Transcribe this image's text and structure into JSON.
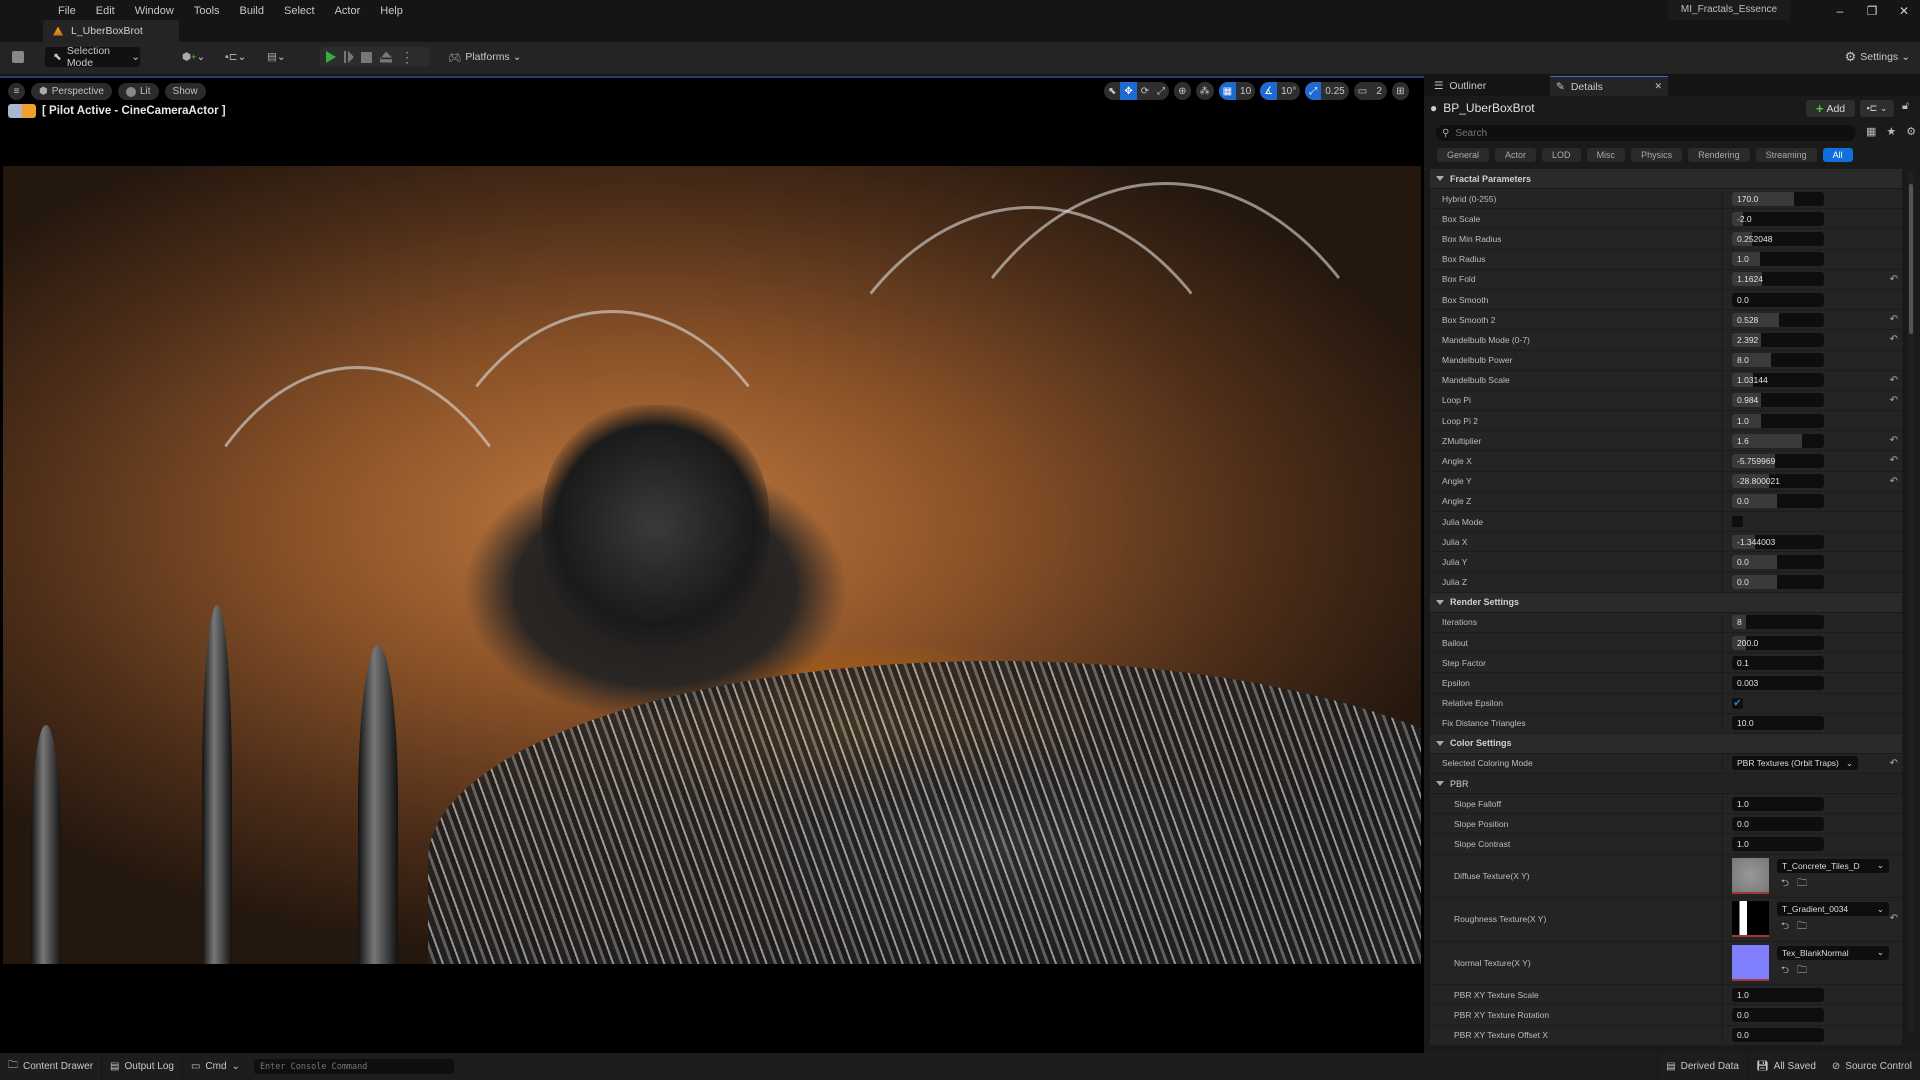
{
  "menu": [
    "File",
    "Edit",
    "Window",
    "Tools",
    "Build",
    "Select",
    "Actor",
    "Help"
  ],
  "level_tab": "L_UberBoxBrot",
  "project_name": "MI_Fractals_Essence",
  "window_controls": {
    "minimize": "–",
    "restore": "❐",
    "close": "✕"
  },
  "toolbar": {
    "save_icon": "save-icon",
    "selection_mode": "Selection Mode",
    "platforms": "Platforms",
    "settings": "Settings"
  },
  "viewport": {
    "menu_icon": "≡",
    "perspective": "Perspective",
    "lit": "Lit",
    "show": "Show",
    "pilot_label": "[ Pilot Active - CineCameraActor ]",
    "grid_snap": "10",
    "rotation_snap": "10°",
    "scale_snap": "0.25",
    "camera_speed": "2"
  },
  "panel": {
    "tabs": {
      "outliner": "Outliner",
      "details": "Details",
      "close": "✕"
    },
    "actor_name": "BP_UberBoxBrot",
    "add_button": "Add",
    "search_placeholder": "Search",
    "filters": [
      "General",
      "Actor",
      "LOD",
      "Misc",
      "Physics",
      "Rendering",
      "Streaming",
      "All"
    ],
    "active_filter": "All",
    "categories": {
      "fractal": {
        "title": "Fractal Parameters",
        "rows": [
          {
            "label": "Hybrid (0-255)",
            "value": "170.0",
            "fill": 0.67,
            "reset": false
          },
          {
            "label": "Box Scale",
            "value": "-2.0",
            "fill": 0.12,
            "reset": false
          },
          {
            "label": "Box Min Radius",
            "value": "0.252048",
            "fill": 0.22,
            "reset": false
          },
          {
            "label": "Box Radius",
            "value": "1.0",
            "fill": 0.3,
            "reset": false
          },
          {
            "label": "Box Fold",
            "value": "1.1624",
            "fill": 0.33,
            "reset": true
          },
          {
            "label": "Box Smooth",
            "value": "0.0",
            "fill": 0.0,
            "reset": false
          },
          {
            "label": "Box Smooth 2",
            "value": "0.528",
            "fill": 0.51,
            "reset": true
          },
          {
            "label": "Mandelbulb Mode (0-7)",
            "value": "2.392",
            "fill": 0.32,
            "reset": true
          },
          {
            "label": "Mandelbulb Power",
            "value": "8.0",
            "fill": 0.42,
            "reset": false
          },
          {
            "label": "Mandelbulb Scale",
            "value": "1.03144",
            "fill": 0.23,
            "reset": true
          },
          {
            "label": "Loop Pi",
            "value": "0.984",
            "fill": 0.32,
            "reset": true
          },
          {
            "label": "Loop Pi 2",
            "value": "1.0",
            "fill": 0.32,
            "reset": false
          },
          {
            "label": "ZMultiplier",
            "value": "1.6",
            "fill": 0.76,
            "reset": true
          },
          {
            "label": "Angle X",
            "value": "-5.759969",
            "fill": 0.47,
            "reset": true
          },
          {
            "label": "Angle Y",
            "value": "-28.800021",
            "fill": 0.4,
            "reset": true
          },
          {
            "label": "Angle Z",
            "value": "0.0",
            "fill": 0.49,
            "reset": false
          },
          {
            "label": "Julia Mode",
            "checkbox": false
          },
          {
            "label": "Julia X",
            "value": "-1.344003",
            "fill": 0.25,
            "reset": false
          },
          {
            "label": "Julia Y",
            "value": "0.0",
            "fill": 0.49,
            "reset": false
          },
          {
            "label": "Julia Z",
            "value": "0.0",
            "fill": 0.49,
            "reset": false
          }
        ]
      },
      "render": {
        "title": "Render Settings",
        "rows": [
          {
            "label": "Iterations",
            "value": "8",
            "fill": 0.15,
            "reset": false
          },
          {
            "label": "Bailout",
            "value": "200.0",
            "fill": 0.15,
            "reset": false
          },
          {
            "label": "Step Factor",
            "value": "0.1",
            "fill": 0.0,
            "reset": false
          },
          {
            "label": "Epsilon",
            "value": "0.003",
            "fill": 0.0,
            "reset": false
          },
          {
            "label": "Relative Epsilon",
            "checkbox": true
          },
          {
            "label": "Fix Distance Triangles",
            "value": "10.0",
            "fill": 0.0,
            "reset": false
          }
        ]
      },
      "color": {
        "title": "Color Settings",
        "coloring_mode_label": "Selected Coloring Mode",
        "coloring_mode_value": "PBR Textures (Orbit Traps)",
        "pbr": {
          "title": "PBR",
          "rows": [
            {
              "label": "Slope Falloff",
              "value": "1.0"
            },
            {
              "label": "Slope Position",
              "value": "0.0"
            },
            {
              "label": "Slope Contrast",
              "value": "1.0"
            }
          ],
          "textures": [
            {
              "label": "Diffuse Texture(X Y)",
              "asset": "T_Concrete_Tiles_D",
              "swatch": "#8a8c8c",
              "reset": false
            },
            {
              "label": "Roughness Texture(X Y)",
              "asset": "T_Gradient_0034",
              "swatch": "#000000",
              "reset": true
            },
            {
              "label": "Normal Texture(X Y)",
              "asset": "Tex_BlankNormal",
              "swatch": "#8080ff",
              "reset": false
            }
          ],
          "rows2": [
            {
              "label": "PBR XY Texture Scale",
              "value": "1.0"
            },
            {
              "label": "PBR XY Texture Rotation",
              "value": "0.0"
            },
            {
              "label": "PBR XY Texture Offset X",
              "value": "0.0"
            }
          ]
        }
      }
    }
  },
  "statusbar": {
    "content_drawer": "Content Drawer",
    "output_log": "Output Log",
    "cmd": "Cmd",
    "console_placeholder": "Enter Console Command",
    "derived_data": "Derived Data",
    "all_saved": "All Saved",
    "source_control": "Source Control"
  },
  "colors": {
    "accent": "#0f6fdc",
    "play": "#35b03a",
    "level_icon": "#f0a020"
  }
}
